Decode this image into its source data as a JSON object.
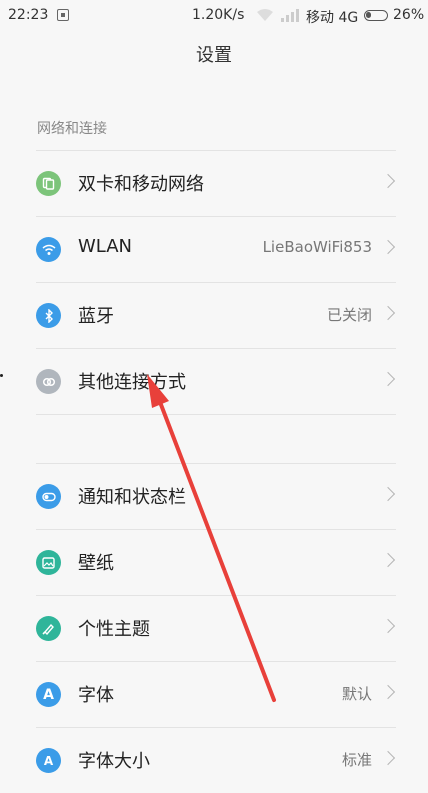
{
  "status": {
    "time": "22:23",
    "speed": "1.20K/s",
    "carrier": "移动 4G",
    "battery_pct": "26%",
    "battery_level": 0.26
  },
  "title": "设置",
  "section1": {
    "header": "网络和连接",
    "items": [
      {
        "label": "双卡和移动网络",
        "value": "",
        "icon": "sim-cards-icon",
        "color": "#7cc47a"
      },
      {
        "label": "WLAN",
        "value": "LieBaoWiFi853",
        "icon": "wifi-icon",
        "color": "#3b9ce8"
      },
      {
        "label": "蓝牙",
        "value": "已关闭",
        "icon": "bluetooth-icon",
        "color": "#3b9ce8"
      },
      {
        "label": "其他连接方式",
        "value": "",
        "icon": "link-icon",
        "color": "#b0b6bd"
      }
    ]
  },
  "section2": {
    "items": [
      {
        "label": "通知和状态栏",
        "value": "",
        "icon": "toggle-icon",
        "color": "#3b9ce8"
      },
      {
        "label": "壁纸",
        "value": "",
        "icon": "wallpaper-icon",
        "color": "#2fb59a"
      },
      {
        "label": "个性主题",
        "value": "",
        "icon": "theme-brush-icon",
        "color": "#2fb59a"
      },
      {
        "label": "字体",
        "value": "默认",
        "icon": "font-a-icon",
        "color": "#3b9ce8"
      },
      {
        "label": "字体大小",
        "value": "标准",
        "icon": "font-size-icon",
        "color": "#3b9ce8"
      }
    ]
  },
  "annotation": {
    "color": "#e8403a"
  }
}
